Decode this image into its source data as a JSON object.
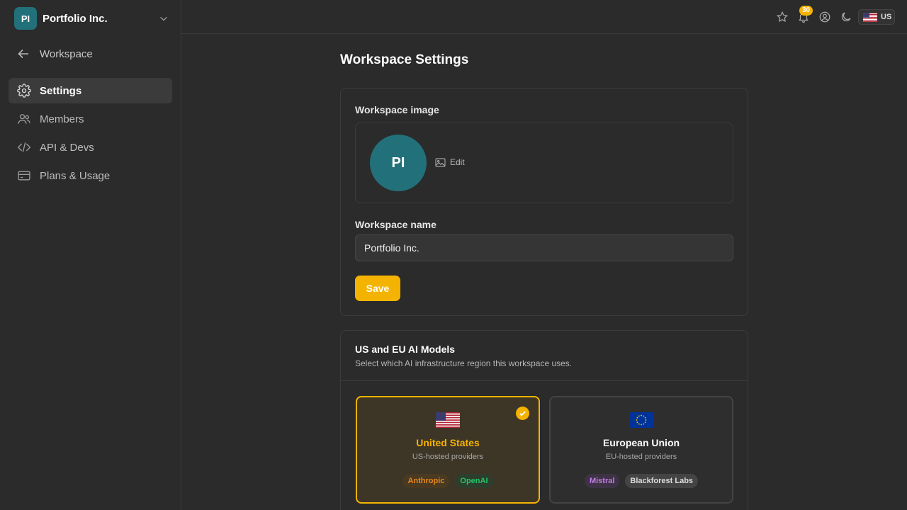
{
  "org": {
    "initials": "PI",
    "name": "Portfolio Inc."
  },
  "sidebar": {
    "back_label": "Workspace",
    "items": [
      {
        "label": "Settings",
        "icon": "gear-icon",
        "active": true
      },
      {
        "label": "Members",
        "icon": "users-icon"
      },
      {
        "label": "API & Devs",
        "icon": "code-icon"
      },
      {
        "label": "Plans & Usage",
        "icon": "credit-card-icon"
      }
    ]
  },
  "topbar": {
    "notification_count": "30",
    "locale": "US",
    "icons": [
      "star-icon",
      "bell-icon",
      "user-circle-icon",
      "moon-icon",
      "us-flag-icon"
    ]
  },
  "page": {
    "title": "Workspace Settings"
  },
  "general": {
    "image_label": "Workspace image",
    "avatar_initials": "PI",
    "edit_label": "Edit",
    "name_label": "Workspace name",
    "name_value": "Portfolio Inc.",
    "save_label": "Save"
  },
  "regions": {
    "title": "US and EU AI Models",
    "subtitle": "Select which AI infrastructure region this workspace uses.",
    "us": {
      "name": "United States",
      "sub": "US-hosted providers",
      "tags": [
        "Anthropic",
        "OpenAI"
      ],
      "selected": true
    },
    "eu": {
      "name": "European Union",
      "sub": "EU-hosted providers",
      "tags": [
        "Mistral",
        "Blackforest Labs"
      ],
      "selected": false
    }
  },
  "colors": {
    "accent": "#f5b301",
    "avatar": "#22707a",
    "background": "#2b2b2b"
  }
}
